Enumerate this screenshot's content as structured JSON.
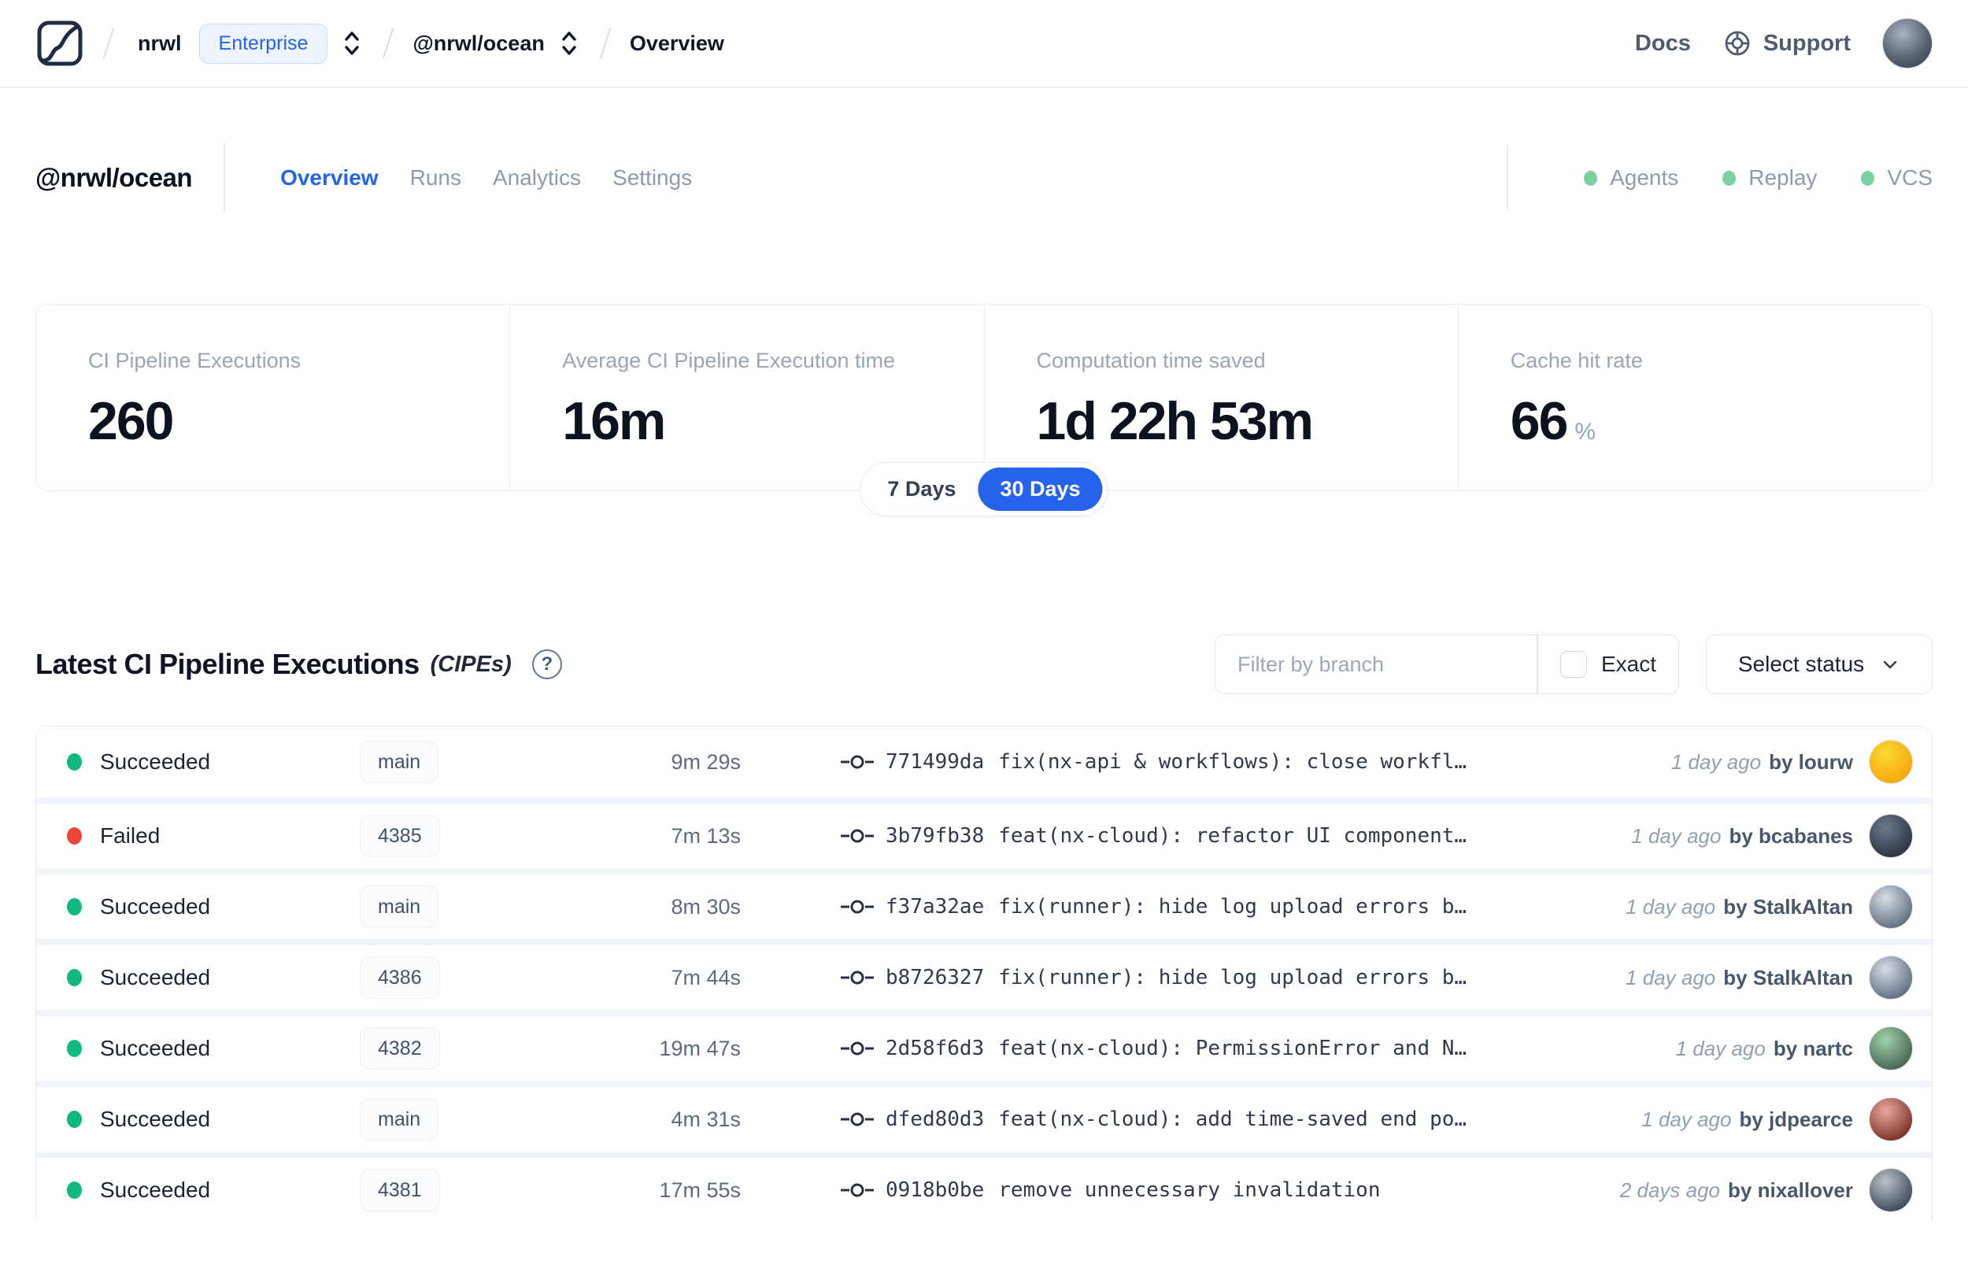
{
  "colors": {
    "accent": "#2563eb",
    "success": "#10b981",
    "failed": "#f04438",
    "feature_dot": "#7ccf9f"
  },
  "navbar": {
    "breadcrumb": {
      "org": "nrwl",
      "org_badge": "Enterprise",
      "workspace": "@nrwl/ocean",
      "page": "Overview"
    },
    "links": {
      "docs": "Docs",
      "support": "Support"
    }
  },
  "header": {
    "title": "@nrwl/ocean",
    "tabs": [
      {
        "label": "Overview",
        "active": true
      },
      {
        "label": "Runs",
        "active": false
      },
      {
        "label": "Analytics",
        "active": false
      },
      {
        "label": "Settings",
        "active": false
      }
    ],
    "features": [
      {
        "label": "Agents"
      },
      {
        "label": "Replay"
      },
      {
        "label": "VCS"
      }
    ]
  },
  "stats": {
    "cards": [
      {
        "label": "CI Pipeline Executions",
        "value": "260",
        "suffix": ""
      },
      {
        "label": "Average CI Pipeline Execution time",
        "value": "16m",
        "suffix": ""
      },
      {
        "label": "Computation time saved",
        "value": "1d 22h 53m",
        "suffix": ""
      },
      {
        "label": "Cache hit rate",
        "value": "66",
        "suffix": "%"
      }
    ],
    "range": {
      "options": [
        "7 Days",
        "30 Days"
      ],
      "selected": "30 Days"
    }
  },
  "section": {
    "title": "Latest CI Pipeline Executions",
    "title_suffix": "(CIPEs)",
    "help_glyph": "?",
    "filter_placeholder": "Filter by branch",
    "exact_label": "Exact",
    "status_dropdown_label": "Select status"
  },
  "table": {
    "rows": [
      {
        "status": "Succeeded",
        "status_color": "#10b981",
        "branch": "main",
        "duration": "9m 29s",
        "commit": "771499da",
        "message": "fix(nx-api & workflows): close workfl…",
        "time": "1 day ago",
        "author": "by lourw",
        "avatar": [
          "#fdd835",
          "#f6a609"
        ]
      },
      {
        "status": "Failed",
        "status_color": "#f04438",
        "branch": "4385",
        "duration": "7m 13s",
        "commit": "3b79fb38",
        "message": "feat(nx-cloud): refactor UI component…",
        "time": "1 day ago",
        "author": "by bcabanes",
        "avatar": [
          "#6b7a8c",
          "#2a3340"
        ]
      },
      {
        "status": "Succeeded",
        "status_color": "#10b981",
        "branch": "main",
        "duration": "8m 30s",
        "commit": "f37a32ae",
        "message": "fix(runner): hide log upload errors b…",
        "time": "1 day ago",
        "author": "by StalkAltan",
        "avatar": [
          "#d7dee6",
          "#5c6b7d"
        ]
      },
      {
        "status": "Succeeded",
        "status_color": "#10b981",
        "branch": "4386",
        "duration": "7m 44s",
        "commit": "b8726327",
        "message": "fix(runner): hide log upload errors b…",
        "time": "1 day ago",
        "author": "by StalkAltan",
        "avatar": [
          "#d7dee6",
          "#5c6b7d"
        ]
      },
      {
        "status": "Succeeded",
        "status_color": "#10b981",
        "branch": "4382",
        "duration": "19m 47s",
        "commit": "2d58f6d3",
        "message": "feat(nx-cloud): PermissionError and N…",
        "time": "1 day ago",
        "author": "by nartc",
        "avatar": [
          "#9fd3a8",
          "#466052"
        ]
      },
      {
        "status": "Succeeded",
        "status_color": "#10b981",
        "branch": "main",
        "duration": "4m 31s",
        "commit": "dfed80d3",
        "message": "feat(nx-cloud): add time-saved end po…",
        "time": "1 day ago",
        "author": "by jdpearce",
        "avatar": [
          "#e8a9a0",
          "#7a2d23"
        ]
      },
      {
        "status": "Succeeded",
        "status_color": "#10b981",
        "branch": "4381",
        "duration": "17m 55s",
        "commit": "0918b0be",
        "message": "remove unnecessary invalidation",
        "time": "2 days ago",
        "author": "by nixallover",
        "avatar": [
          "#b9c2cc",
          "#3c4654"
        ]
      }
    ]
  }
}
